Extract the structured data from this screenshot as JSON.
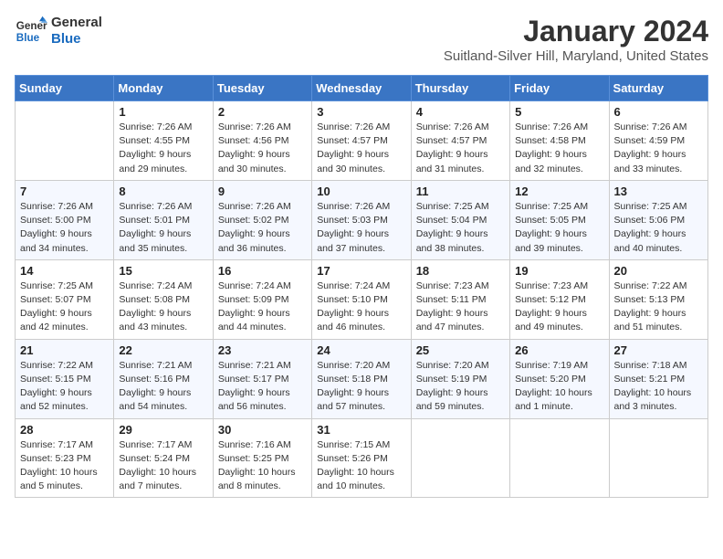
{
  "header": {
    "logo_line1": "General",
    "logo_line2": "Blue",
    "month_title": "January 2024",
    "location": "Suitland-Silver Hill, Maryland, United States"
  },
  "weekdays": [
    "Sunday",
    "Monday",
    "Tuesday",
    "Wednesday",
    "Thursday",
    "Friday",
    "Saturday"
  ],
  "weeks": [
    [
      {
        "day": "",
        "sunrise": "",
        "sunset": "",
        "daylight": ""
      },
      {
        "day": "1",
        "sunrise": "Sunrise: 7:26 AM",
        "sunset": "Sunset: 4:55 PM",
        "daylight": "Daylight: 9 hours and 29 minutes."
      },
      {
        "day": "2",
        "sunrise": "Sunrise: 7:26 AM",
        "sunset": "Sunset: 4:56 PM",
        "daylight": "Daylight: 9 hours and 30 minutes."
      },
      {
        "day": "3",
        "sunrise": "Sunrise: 7:26 AM",
        "sunset": "Sunset: 4:57 PM",
        "daylight": "Daylight: 9 hours and 30 minutes."
      },
      {
        "day": "4",
        "sunrise": "Sunrise: 7:26 AM",
        "sunset": "Sunset: 4:57 PM",
        "daylight": "Daylight: 9 hours and 31 minutes."
      },
      {
        "day": "5",
        "sunrise": "Sunrise: 7:26 AM",
        "sunset": "Sunset: 4:58 PM",
        "daylight": "Daylight: 9 hours and 32 minutes."
      },
      {
        "day": "6",
        "sunrise": "Sunrise: 7:26 AM",
        "sunset": "Sunset: 4:59 PM",
        "daylight": "Daylight: 9 hours and 33 minutes."
      }
    ],
    [
      {
        "day": "7",
        "sunrise": "Sunrise: 7:26 AM",
        "sunset": "Sunset: 5:00 PM",
        "daylight": "Daylight: 9 hours and 34 minutes."
      },
      {
        "day": "8",
        "sunrise": "Sunrise: 7:26 AM",
        "sunset": "Sunset: 5:01 PM",
        "daylight": "Daylight: 9 hours and 35 minutes."
      },
      {
        "day": "9",
        "sunrise": "Sunrise: 7:26 AM",
        "sunset": "Sunset: 5:02 PM",
        "daylight": "Daylight: 9 hours and 36 minutes."
      },
      {
        "day": "10",
        "sunrise": "Sunrise: 7:26 AM",
        "sunset": "Sunset: 5:03 PM",
        "daylight": "Daylight: 9 hours and 37 minutes."
      },
      {
        "day": "11",
        "sunrise": "Sunrise: 7:25 AM",
        "sunset": "Sunset: 5:04 PM",
        "daylight": "Daylight: 9 hours and 38 minutes."
      },
      {
        "day": "12",
        "sunrise": "Sunrise: 7:25 AM",
        "sunset": "Sunset: 5:05 PM",
        "daylight": "Daylight: 9 hours and 39 minutes."
      },
      {
        "day": "13",
        "sunrise": "Sunrise: 7:25 AM",
        "sunset": "Sunset: 5:06 PM",
        "daylight": "Daylight: 9 hours and 40 minutes."
      }
    ],
    [
      {
        "day": "14",
        "sunrise": "Sunrise: 7:25 AM",
        "sunset": "Sunset: 5:07 PM",
        "daylight": "Daylight: 9 hours and 42 minutes."
      },
      {
        "day": "15",
        "sunrise": "Sunrise: 7:24 AM",
        "sunset": "Sunset: 5:08 PM",
        "daylight": "Daylight: 9 hours and 43 minutes."
      },
      {
        "day": "16",
        "sunrise": "Sunrise: 7:24 AM",
        "sunset": "Sunset: 5:09 PM",
        "daylight": "Daylight: 9 hours and 44 minutes."
      },
      {
        "day": "17",
        "sunrise": "Sunrise: 7:24 AM",
        "sunset": "Sunset: 5:10 PM",
        "daylight": "Daylight: 9 hours and 46 minutes."
      },
      {
        "day": "18",
        "sunrise": "Sunrise: 7:23 AM",
        "sunset": "Sunset: 5:11 PM",
        "daylight": "Daylight: 9 hours and 47 minutes."
      },
      {
        "day": "19",
        "sunrise": "Sunrise: 7:23 AM",
        "sunset": "Sunset: 5:12 PM",
        "daylight": "Daylight: 9 hours and 49 minutes."
      },
      {
        "day": "20",
        "sunrise": "Sunrise: 7:22 AM",
        "sunset": "Sunset: 5:13 PM",
        "daylight": "Daylight: 9 hours and 51 minutes."
      }
    ],
    [
      {
        "day": "21",
        "sunrise": "Sunrise: 7:22 AM",
        "sunset": "Sunset: 5:15 PM",
        "daylight": "Daylight: 9 hours and 52 minutes."
      },
      {
        "day": "22",
        "sunrise": "Sunrise: 7:21 AM",
        "sunset": "Sunset: 5:16 PM",
        "daylight": "Daylight: 9 hours and 54 minutes."
      },
      {
        "day": "23",
        "sunrise": "Sunrise: 7:21 AM",
        "sunset": "Sunset: 5:17 PM",
        "daylight": "Daylight: 9 hours and 56 minutes."
      },
      {
        "day": "24",
        "sunrise": "Sunrise: 7:20 AM",
        "sunset": "Sunset: 5:18 PM",
        "daylight": "Daylight: 9 hours and 57 minutes."
      },
      {
        "day": "25",
        "sunrise": "Sunrise: 7:20 AM",
        "sunset": "Sunset: 5:19 PM",
        "daylight": "Daylight: 9 hours and 59 minutes."
      },
      {
        "day": "26",
        "sunrise": "Sunrise: 7:19 AM",
        "sunset": "Sunset: 5:20 PM",
        "daylight": "Daylight: 10 hours and 1 minute."
      },
      {
        "day": "27",
        "sunrise": "Sunrise: 7:18 AM",
        "sunset": "Sunset: 5:21 PM",
        "daylight": "Daylight: 10 hours and 3 minutes."
      }
    ],
    [
      {
        "day": "28",
        "sunrise": "Sunrise: 7:17 AM",
        "sunset": "Sunset: 5:23 PM",
        "daylight": "Daylight: 10 hours and 5 minutes."
      },
      {
        "day": "29",
        "sunrise": "Sunrise: 7:17 AM",
        "sunset": "Sunset: 5:24 PM",
        "daylight": "Daylight: 10 hours and 7 minutes."
      },
      {
        "day": "30",
        "sunrise": "Sunrise: 7:16 AM",
        "sunset": "Sunset: 5:25 PM",
        "daylight": "Daylight: 10 hours and 8 minutes."
      },
      {
        "day": "31",
        "sunrise": "Sunrise: 7:15 AM",
        "sunset": "Sunset: 5:26 PM",
        "daylight": "Daylight: 10 hours and 10 minutes."
      },
      {
        "day": "",
        "sunrise": "",
        "sunset": "",
        "daylight": ""
      },
      {
        "day": "",
        "sunrise": "",
        "sunset": "",
        "daylight": ""
      },
      {
        "day": "",
        "sunrise": "",
        "sunset": "",
        "daylight": ""
      }
    ]
  ]
}
